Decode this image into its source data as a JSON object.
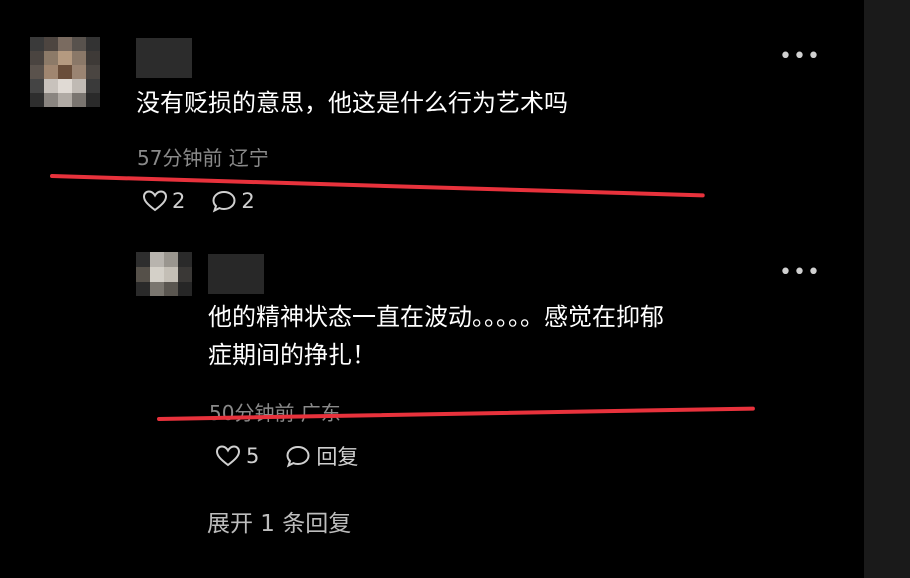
{
  "colors": {
    "background": "#000000",
    "text": "#ffffff",
    "meta": "#8a8a8a",
    "underline": "#e8323c"
  },
  "comment": {
    "more_icon": "•••",
    "text": "没有贬损的意思，他这是什么行为艺术吗",
    "meta": "57分钟前 辽宁",
    "likes": "2",
    "replies": "2"
  },
  "reply": {
    "more_icon": "•••",
    "text_line1": "他的精神状态一直在波动。。。。。感觉在抑郁",
    "text_line2": "症期间的挣扎！",
    "meta": "50分钟前 广东",
    "likes": "5",
    "reply_label": "回复"
  },
  "expand_label": "展开 1 条回复"
}
